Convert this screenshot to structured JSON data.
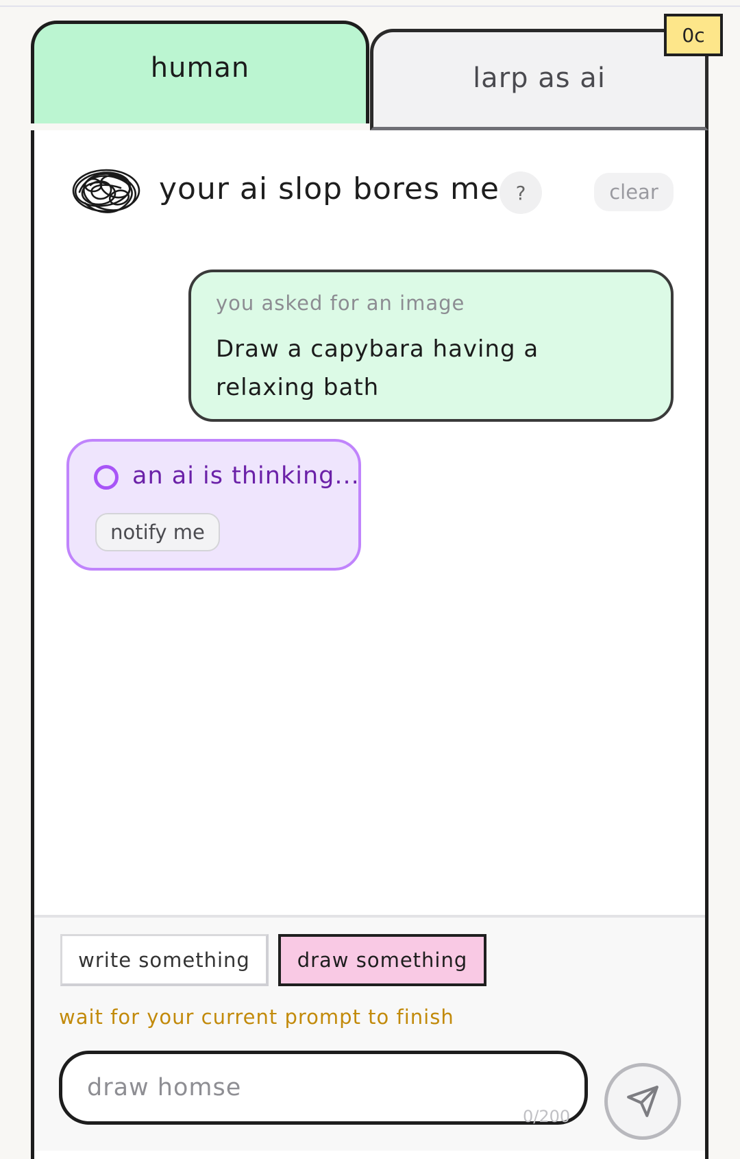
{
  "tabs": [
    {
      "label": "human",
      "active": true
    },
    {
      "label": "larp as ai",
      "active": false
    }
  ],
  "credits": {
    "label": "0c"
  },
  "header": {
    "title": "your ai slop bores me",
    "help_label": "?",
    "clear_label": "clear"
  },
  "messages": {
    "user": {
      "kicker": "you asked for an image",
      "text": "Draw a capybara having a relaxing bath"
    },
    "ai": {
      "status": "an ai is thinking...",
      "notify_label": "notify me"
    }
  },
  "composer": {
    "modes": [
      {
        "label": "write something",
        "active": false
      },
      {
        "label": "draw something",
        "active": true
      }
    ],
    "notice": "wait for your current prompt to finish",
    "placeholder": "draw homse",
    "char_count": "0/200"
  },
  "colors": {
    "human_tab": "#bbf5d1",
    "user_bubble": "#dcfae6",
    "ai_bubble": "#efe5fd",
    "ai_accent": "#a855f7",
    "draw_mode": "#f9c9e4",
    "credit_badge": "#fde68a",
    "notice": "#c28a0b"
  },
  "icons": {
    "avatar": "scribble-avatar-icon",
    "send": "send-icon",
    "spinner": "spinner-icon"
  }
}
